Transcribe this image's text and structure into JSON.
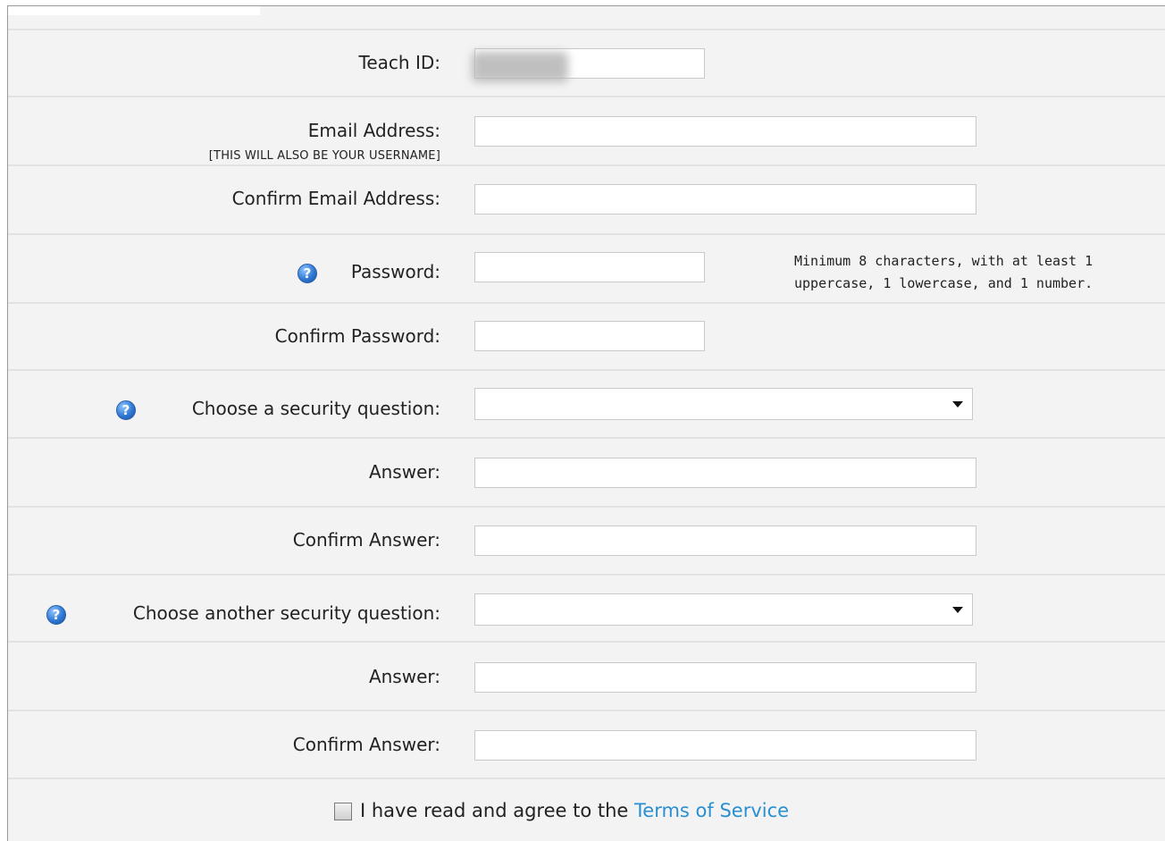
{
  "form": {
    "teach_id_label": "Teach ID:",
    "teach_id_value": "",
    "email_label": "Email Address:",
    "email_note": "[THIS WILL ALSO BE YOUR USERNAME]",
    "email_value": "",
    "confirm_email_label": "Confirm Email Address:",
    "confirm_email_value": "",
    "password_label": "Password:",
    "password_hint_line1": "Minimum 8 characters, with at least 1",
    "password_hint_line2": "uppercase, 1 lowercase, and 1 number.",
    "confirm_password_label": "Confirm Password:",
    "security_q1_label": "Choose a security question:",
    "security_q1_selected": "",
    "answer1_label": "Answer:",
    "answer1_value": "",
    "confirm_answer1_label": "Confirm Answer:",
    "confirm_answer1_value": "",
    "security_q2_label": "Choose another security question:",
    "security_q2_selected": "",
    "answer2_label": "Answer:",
    "answer2_value": "",
    "confirm_answer2_label": "Confirm Answer:",
    "confirm_answer2_value": "",
    "terms_prefix": "I have read and agree to the",
    "terms_link": "Terms of Service",
    "terms_checked": false
  },
  "icons": {
    "help": "help-question-icon",
    "dropdown": "chevron-down-icon"
  },
  "colors": {
    "panel_bg": "#f3f3f3",
    "row_divider": "#e2e2e2",
    "link": "#2a8fd0",
    "help_icon": "#2f78d4"
  }
}
